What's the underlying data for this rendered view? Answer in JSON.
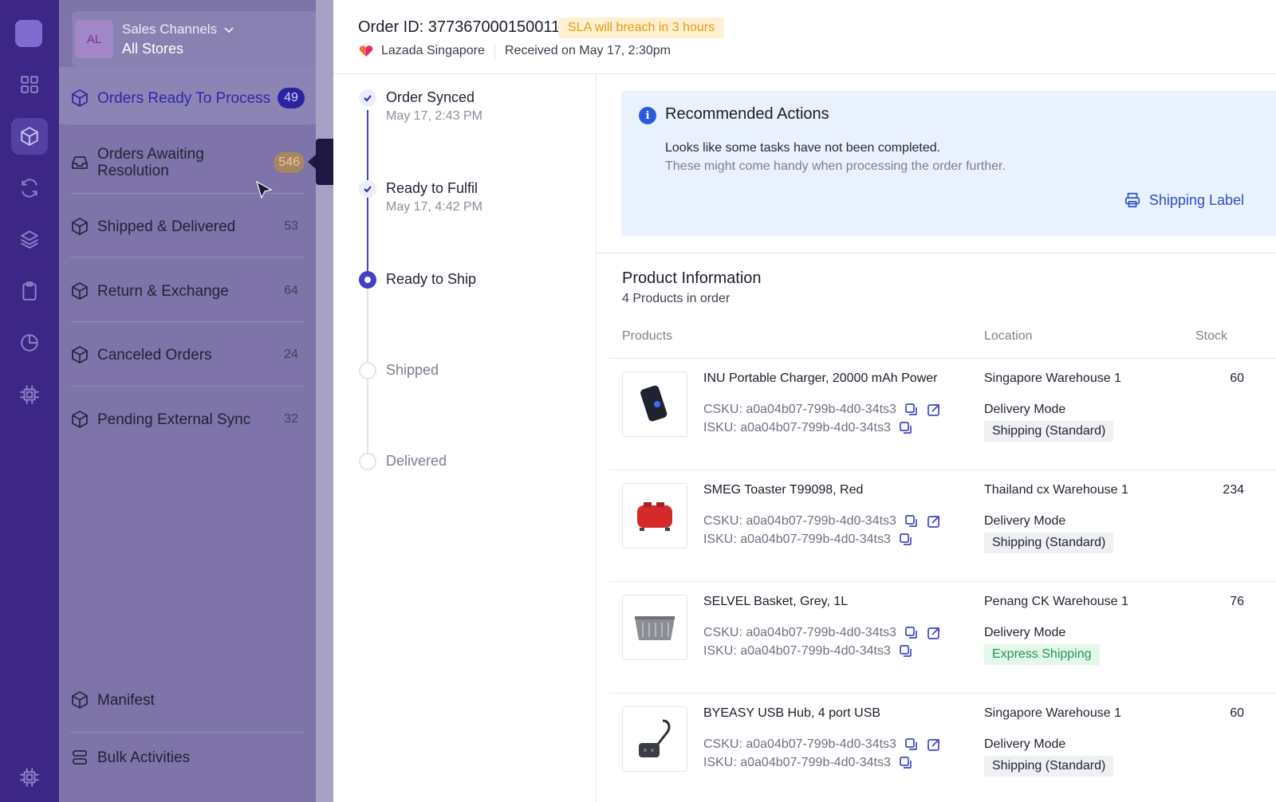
{
  "sidebar": {
    "store": {
      "avatar": "AL",
      "channel_label": "Sales Channels",
      "store_name": "All Stores"
    },
    "nav": [
      {
        "label": "Orders Ready To Process",
        "count": "49"
      },
      {
        "label": "Orders Awaiting Resolution",
        "count": "546"
      },
      {
        "label": "Shipped & Delivered",
        "count": "53"
      },
      {
        "label": "Return & Exchange",
        "count": "64"
      },
      {
        "label": "Canceled Orders",
        "count": "24"
      },
      {
        "label": "Pending External Sync",
        "count": "32"
      }
    ],
    "footer": [
      {
        "label": "Manifest"
      },
      {
        "label": "Bulk Activities"
      }
    ]
  },
  "order": {
    "id_label": "Order ID: 377367000150011",
    "sla": "SLA will breach in 3 hours",
    "channel": "Lazada Singapore",
    "received": "Received on May 17, 2:30pm"
  },
  "timeline": [
    {
      "label": "Order Synced",
      "time": "May 17, 2:43 PM",
      "state": "done"
    },
    {
      "label": "Ready to Fulfil",
      "time": "May 17, 4:42 PM",
      "state": "done"
    },
    {
      "label": "Ready to Ship",
      "time": "",
      "state": "current"
    },
    {
      "label": "Shipped",
      "time": "",
      "state": "todo"
    },
    {
      "label": "Delivered",
      "time": "",
      "state": "todo"
    }
  ],
  "recommended": {
    "title": "Recommended Actions",
    "line1": "Looks like some tasks have not been completed.",
    "line2": "These might come handy when processing the order further.",
    "action": "Shipping Label"
  },
  "products": {
    "title": "Product Information",
    "subtitle": "4 Products in order",
    "columns": [
      "Products",
      "Location",
      "Stock"
    ],
    "delivery_mode_label": "Delivery Mode",
    "rows": [
      {
        "name": "INU Portable Charger, 20000 mAh Power",
        "csku": "CSKU: a0a04b07-799b-4d0-34ts3",
        "isku": "ISKU: a0a04b07-799b-4d0-34ts3",
        "location": "Singapore Warehouse 1",
        "mode": "Shipping (Standard)",
        "stock": "60"
      },
      {
        "name": "SMEG Toaster T99098, Red",
        "csku": "CSKU: a0a04b07-799b-4d0-34ts3",
        "isku": "ISKU: a0a04b07-799b-4d0-34ts3",
        "location": "Thailand cx Warehouse 1",
        "mode": "Shipping (Standard)",
        "stock": "234"
      },
      {
        "name": "SELVEL Basket, Grey, 1L",
        "csku": "CSKU: a0a04b07-799b-4d0-34ts3",
        "isku": "ISKU: a0a04b07-799b-4d0-34ts3",
        "location": "Penang CK Warehouse 1",
        "mode": "Express Shipping",
        "stock": "76"
      },
      {
        "name": "BYEASY USB Hub, 4 port USB",
        "csku": "CSKU: a0a04b07-799b-4d0-34ts3",
        "isku": "ISKU: a0a04b07-799b-4d0-34ts3",
        "location": "Singapore Warehouse 1",
        "mode": "Shipping (Standard)",
        "stock": "60"
      }
    ]
  },
  "icons": {
    "rail": [
      "grid-icon",
      "box-icon",
      "sync-icon",
      "layers-icon",
      "clipboard-icon",
      "pie-chart-icon",
      "chip-icon",
      "chip-icon"
    ],
    "sku_actions": [
      "copy-icon",
      "open-link-icon"
    ]
  },
  "colors": {
    "accent": "#4340c6",
    "sla_bg": "#fff1d2",
    "sla_text": "#e89a10",
    "express_text": "#1f9a4e",
    "info_bg": "#e9f1fc"
  }
}
